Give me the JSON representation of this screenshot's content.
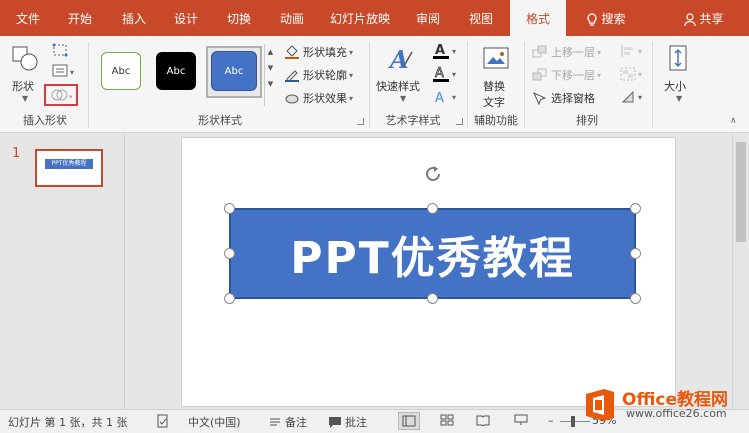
{
  "tabs": [
    "文件",
    "开始",
    "插入",
    "设计",
    "切换",
    "动画",
    "幻灯片放映",
    "审阅",
    "视图",
    "格式"
  ],
  "tell_me": "搜索",
  "share": "共享",
  "insert_shapes": {
    "shapes_label": "形状",
    "group": "插入形状"
  },
  "shape_styles": {
    "swatch": "Abc",
    "fill": "形状填充",
    "outline": "形状轮廓",
    "effect": "形状效果",
    "group": "形状样式"
  },
  "wordart": {
    "quick": "快速样式",
    "group": "艺术字样式"
  },
  "alt_text": {
    "label": "替换\n文字",
    "line1": "替换",
    "line2": "文字",
    "group": "辅助功能"
  },
  "arrange": {
    "forward": "上移一层",
    "backward": "下移一层",
    "pane": "选择窗格",
    "group": "排列"
  },
  "size": {
    "label": "大小"
  },
  "slides": [
    {
      "number": "1",
      "thumb_text": "PPT优秀教程"
    }
  ],
  "slide_shape_text": "PPT优秀教程",
  "status": {
    "slide_info": "幻灯片 第 1 张，共 1 张",
    "language": "中文(中国)",
    "notes": "备注",
    "comments": "批注",
    "zoom": "59%"
  },
  "watermark": {
    "line1": "Office教程网",
    "line2": "www.office26.com"
  },
  "colors": {
    "accent": "#c8492a",
    "shape_fill": "#4472c4",
    "shape_border": "#2f5597",
    "watermark_orange": "#e8590c"
  }
}
